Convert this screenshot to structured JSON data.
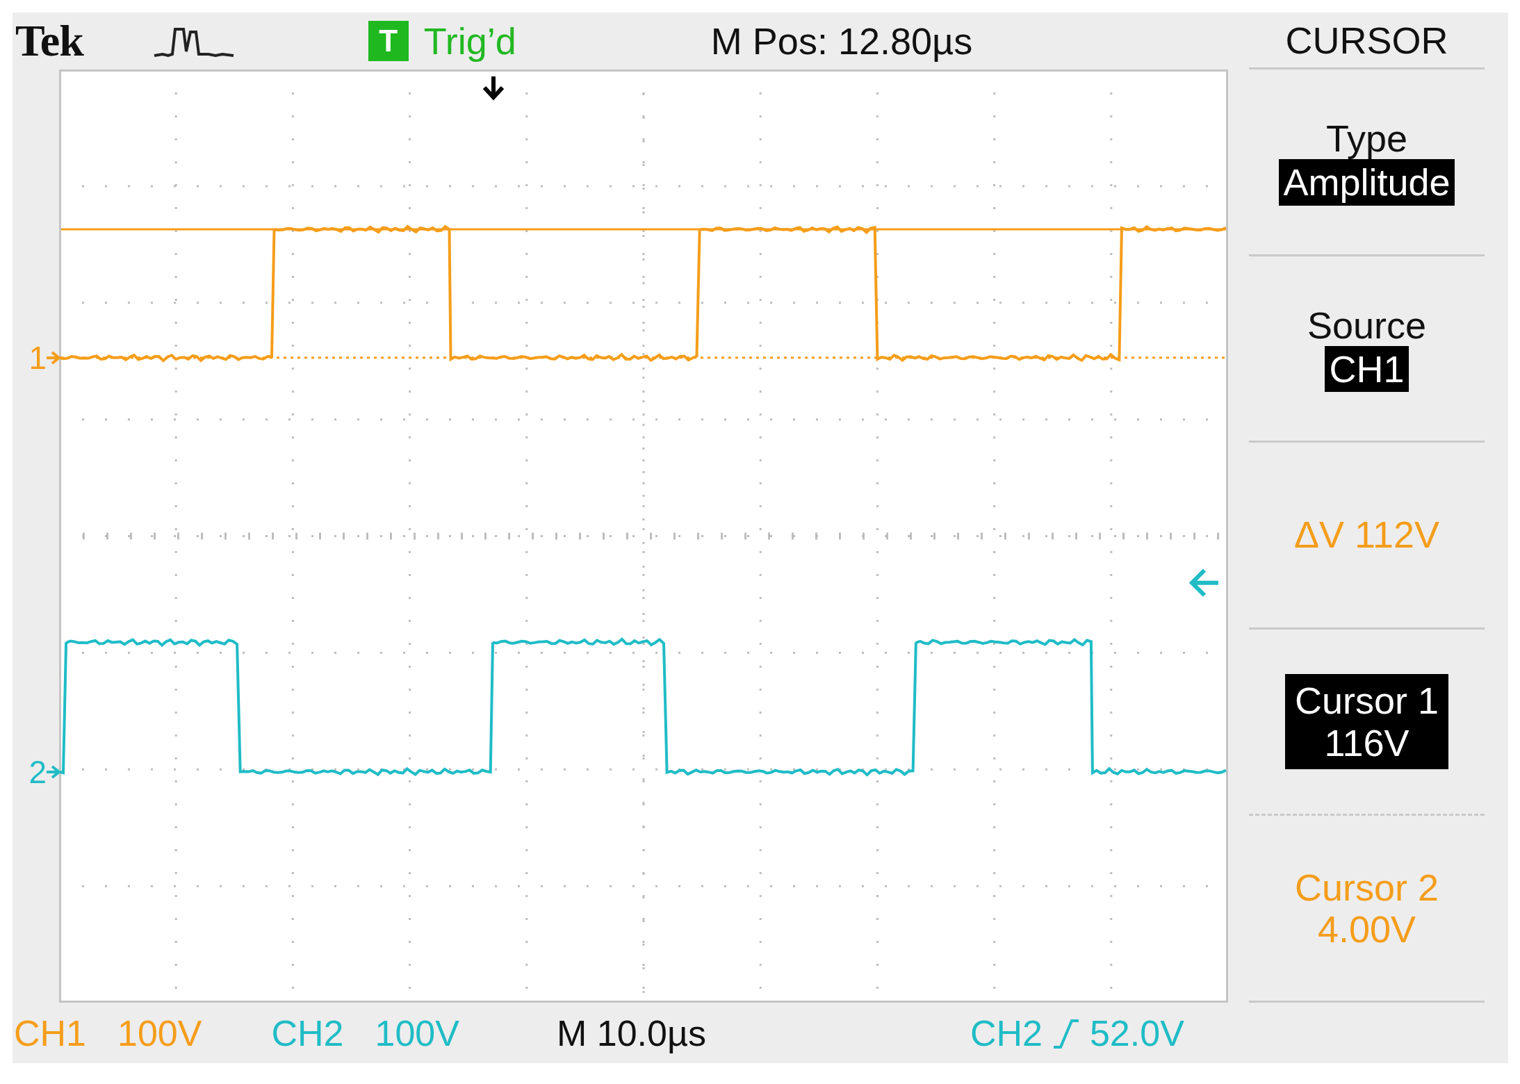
{
  "header": {
    "brand": "Tek",
    "trigger_badge": "T",
    "trigger_status": "Trig’d",
    "position": "M Pos: 12.80µs"
  },
  "channel_markers": [
    {
      "label": "1",
      "color": "#f59d1a"
    },
    {
      "label": "2",
      "color": "#1fbcc6"
    }
  ],
  "menu": {
    "title": "CURSOR",
    "items": [
      {
        "kind": "option",
        "label": "Type",
        "value": "Amplitude"
      },
      {
        "kind": "option",
        "label": "Source",
        "value": "CH1"
      },
      {
        "kind": "readout",
        "text": "ΔV 112V"
      },
      {
        "kind": "cursor",
        "label": "Cursor 1",
        "value": "116V",
        "selected": true
      },
      {
        "kind": "cursor",
        "label": "Cursor 2",
        "value": "4.00V",
        "selected": false
      }
    ]
  },
  "footer": {
    "channels": [
      {
        "name": "CH1",
        "scale": "100V",
        "color": "#f59d1a"
      },
      {
        "name": "CH2",
        "scale": "100V",
        "color": "#1fbcc6"
      }
    ],
    "timebase": "M 10.0µs",
    "trigger": {
      "source": "CH2",
      "level": "52.0V",
      "color": "#1fbcc6"
    }
  }
}
